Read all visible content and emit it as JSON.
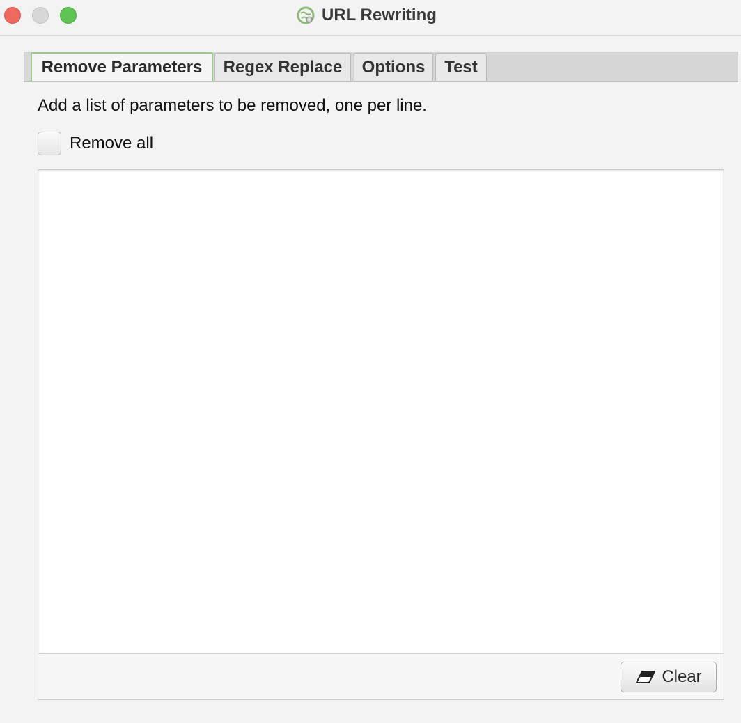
{
  "window": {
    "title": "URL Rewriting",
    "app_icon": "globe-settings-icon"
  },
  "tabs": [
    {
      "label": "Remove Parameters",
      "active": true
    },
    {
      "label": "Regex Replace",
      "active": false
    },
    {
      "label": "Options",
      "active": false
    },
    {
      "label": "Test",
      "active": false
    }
  ],
  "remove_parameters": {
    "instructions": "Add a list of parameters to be removed, one per line.",
    "remove_all_label": "Remove all",
    "remove_all_checked": false,
    "parameters_text": "",
    "clear_label": "Clear",
    "clear_icon": "eraser-icon"
  },
  "colors": {
    "active_tab_border": "#9cc983",
    "close": "#ee6a5f",
    "minimize": "#d7d7d7",
    "maximize": "#5fc454"
  }
}
